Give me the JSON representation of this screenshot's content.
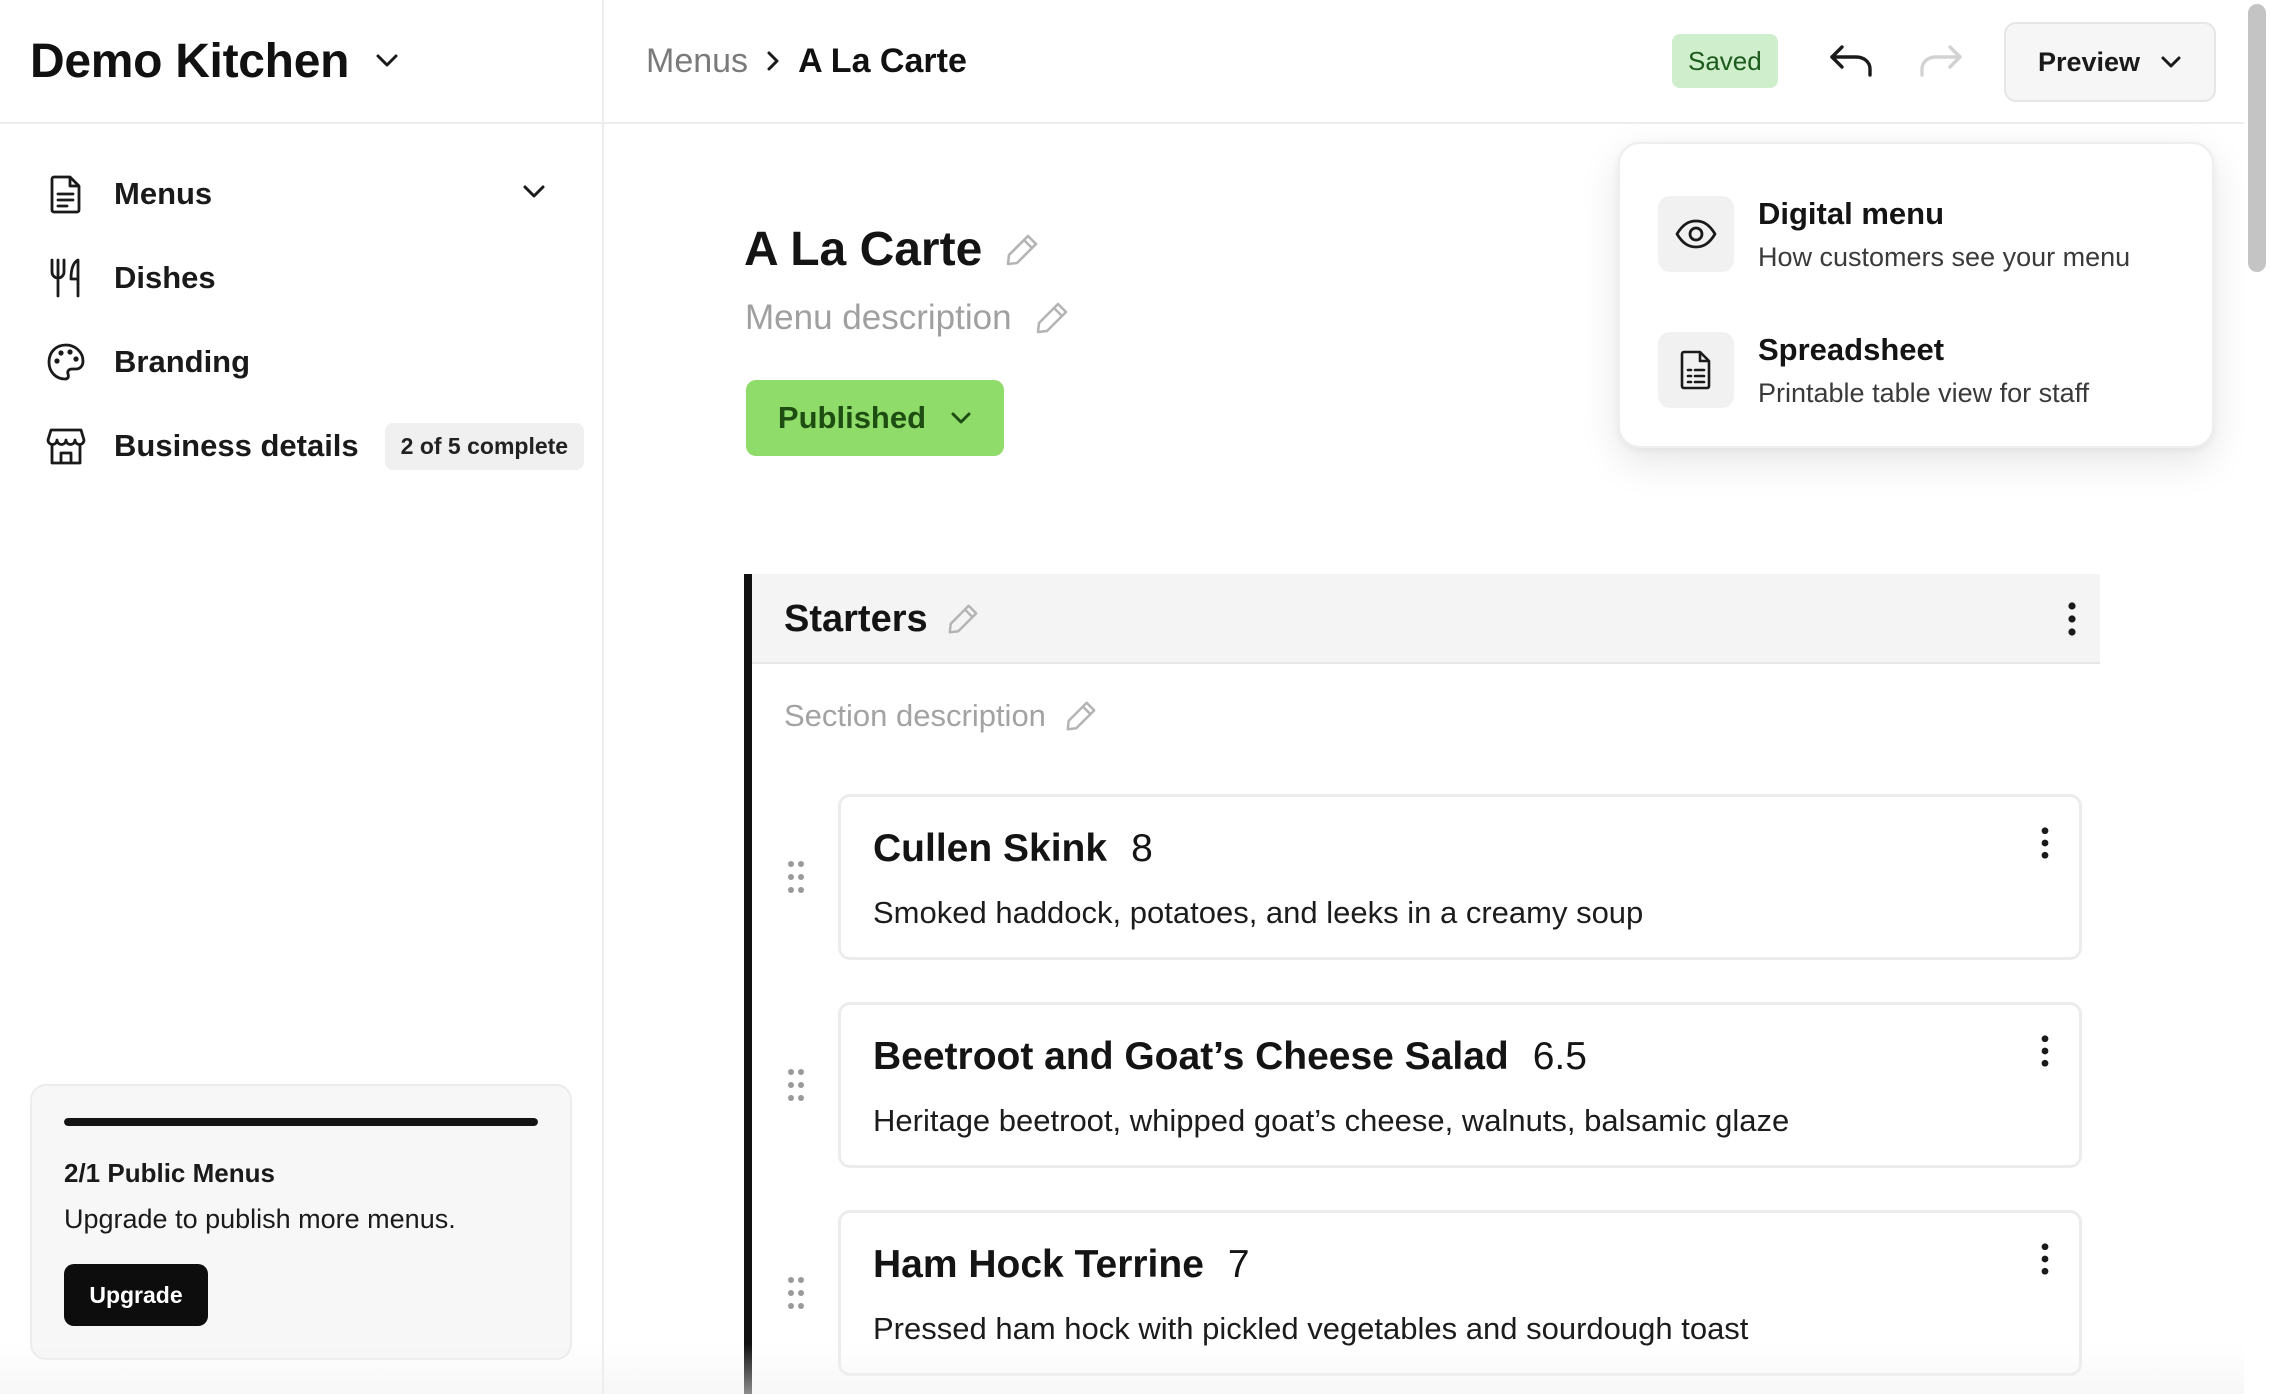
{
  "workspace": {
    "name": "Demo Kitchen"
  },
  "sidebar": {
    "items": [
      {
        "label": "Menus",
        "icon": "document-icon"
      },
      {
        "label": "Dishes",
        "icon": "utensils-icon"
      },
      {
        "label": "Branding",
        "icon": "palette-icon"
      },
      {
        "label": "Business details",
        "icon": "storefront-icon",
        "badge": "2 of 5 complete"
      }
    ]
  },
  "plan": {
    "title": "2/1 Public Menus",
    "description": "Upgrade to publish more menus.",
    "upgrade_label": "Upgrade",
    "usage_fraction": 1.0
  },
  "header": {
    "breadcrumb": {
      "parent": "Menus",
      "current": "A La Carte"
    },
    "saved_label": "Saved",
    "preview_label": "Preview"
  },
  "preview_menu": {
    "items": [
      {
        "title": "Digital menu",
        "subtitle": "How customers see your menu",
        "icon": "eye-icon"
      },
      {
        "title": "Spreadsheet",
        "subtitle": "Printable table view for staff",
        "icon": "spreadsheet-icon"
      }
    ]
  },
  "menu": {
    "title": "A La Carte",
    "description_placeholder": "Menu description",
    "status_label": "Published"
  },
  "section": {
    "title": "Starters",
    "description_placeholder": "Section description",
    "dishes": [
      {
        "name": "Cullen Skink",
        "price": "8",
        "description": "Smoked haddock, potatoes, and leeks in a creamy soup"
      },
      {
        "name": "Beetroot and Goat’s Cheese Salad",
        "price": "6.5",
        "description": "Heritage beetroot, whipped goat’s cheese, walnuts, balsamic glaze"
      },
      {
        "name": "Ham Hock Terrine",
        "price": "7",
        "description": "Pressed ham hock with pickled vegetables and sourdough toast"
      }
    ]
  },
  "colors": {
    "published": "#8fdc6b",
    "saved_badge": "#cfeecb",
    "text": "#151515",
    "muted": "#a0a0a0"
  }
}
